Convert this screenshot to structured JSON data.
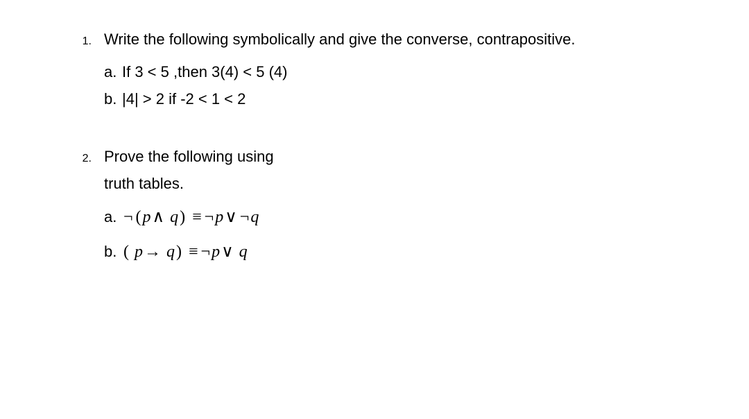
{
  "problems": [
    {
      "number": "1.",
      "text": "Write the following symbolically and give the converse, contrapositive.",
      "subs": [
        {
          "label": "a.",
          "content": "If 3 < 5 ,then 3(4) < 5 (4)"
        },
        {
          "label": "b.",
          "content": "|4| > 2 if -2 < 1 < 2"
        }
      ]
    },
    {
      "number": "2.",
      "text": "Prove the following using",
      "extra_line": "truth tables.",
      "subs": [
        {
          "label": "a.",
          "math": {
            "lhs_not": "¬",
            "lp": "(",
            "p1": "p",
            "and": "∧",
            "q1": "q",
            "rp": ")",
            "equiv": "≡",
            "rhs_not1": "¬",
            "p2": "p",
            "or": "∨",
            "rhs_not2": "¬",
            "q2": "q"
          }
        },
        {
          "label": "b.",
          "math2": {
            "lp": "(",
            "sp": " ",
            "p1": "p",
            "arrow": "→",
            "q1": "q",
            "rp": ")",
            "equiv": "≡",
            "not": "¬",
            "p2": "p",
            "or": "∨",
            "q2": "q"
          }
        }
      ]
    }
  ]
}
